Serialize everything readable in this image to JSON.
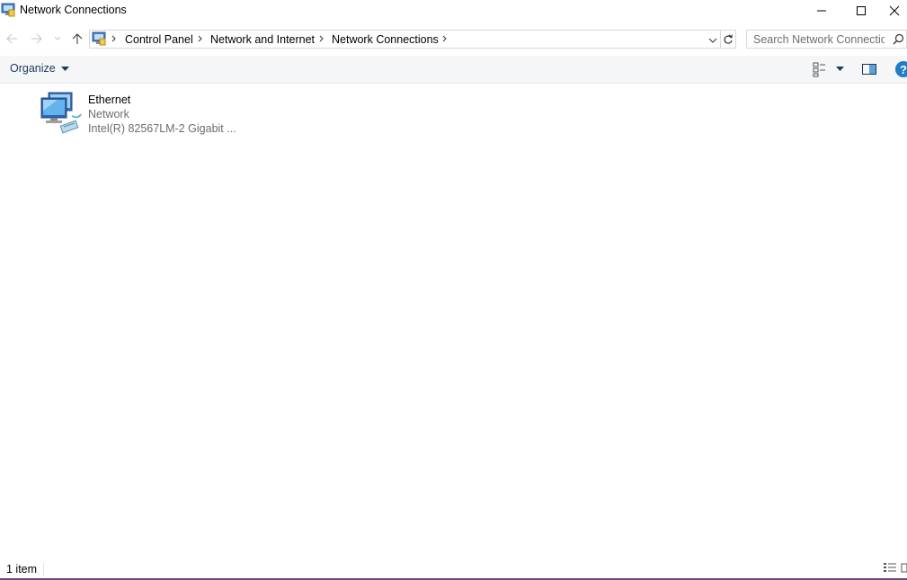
{
  "window": {
    "title": "Network Connections",
    "controls": {
      "minimize": "minimize",
      "maximize": "maximize",
      "close": "close"
    }
  },
  "address_bar": {
    "breadcrumbs": [
      "Control Panel",
      "Network and Internet",
      "Network Connections"
    ],
    "search_placeholder": "Search Network Connectio"
  },
  "command_bar": {
    "organize_label": "Organize"
  },
  "content": {
    "items": [
      {
        "name": "Ethernet",
        "status": "Network",
        "device": "Intel(R) 82567LM-2 Gigabit ..."
      }
    ]
  },
  "status_bar": {
    "item_count": "1 item"
  },
  "colors": {
    "command_bar_bg": "#f5f6f7",
    "link_text": "#1e395b",
    "secondary_text": "#6d6d6d",
    "help_icon": "#1e7ec8"
  }
}
